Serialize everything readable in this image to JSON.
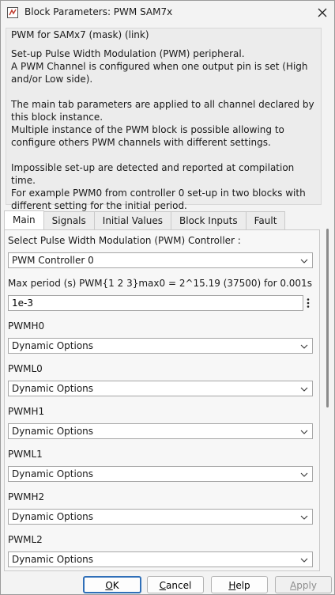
{
  "window": {
    "title": "Block Parameters: PWM SAM7x"
  },
  "description": {
    "mask_title": "PWM for SAMx7 (mask) (link)",
    "text": "Set-up Pulse Width Modulation (PWM) peripheral.\nA PWM Channel is configured when one output pin is set (High and/or Low side).\n\nThe main tab parameters are applied to all channel declared by this block instance.\nMultiple instance of the PWM block is possible allowing to configure others PWM channels with different settings.\n\nImpossible set-up are detected and reported at compilation time.\nFor example PWM0 from controller 0 set-up in two blocks with different setting for the initial period."
  },
  "tabs": [
    "Main",
    "Signals",
    "Initial Values",
    "Block Inputs",
    "Fault"
  ],
  "main": {
    "controller_label": "Select Pulse Width Modulation (PWM) Controller :",
    "controller_value": "PWM Controller 0",
    "max_period_label": "Max period (s)  PWM{1 2 3}max0 = 2^15.19 (37500) for 0.001s",
    "max_period_value": "1e-3",
    "pins": [
      {
        "label": "PWMH0",
        "value": "Dynamic Options"
      },
      {
        "label": "PWML0",
        "value": "Dynamic Options"
      },
      {
        "label": "PWMH1",
        "value": "Dynamic Options"
      },
      {
        "label": "PWML1",
        "value": "Dynamic Options"
      },
      {
        "label": "PWMH2",
        "value": "Dynamic Options"
      },
      {
        "label": "PWML2",
        "value": "Dynamic Options"
      }
    ]
  },
  "buttons": {
    "ok_mnemonic": "O",
    "ok_rest": "K",
    "cancel_mnemonic": "C",
    "cancel_rest": "ancel",
    "help_mnemonic": "H",
    "help_rest": "elp",
    "apply_mnemonic": "A",
    "apply_rest": "pply"
  },
  "colors": {
    "default_button_border": "#2f6fb8",
    "scroll_thumb": "#8a8a8a"
  }
}
